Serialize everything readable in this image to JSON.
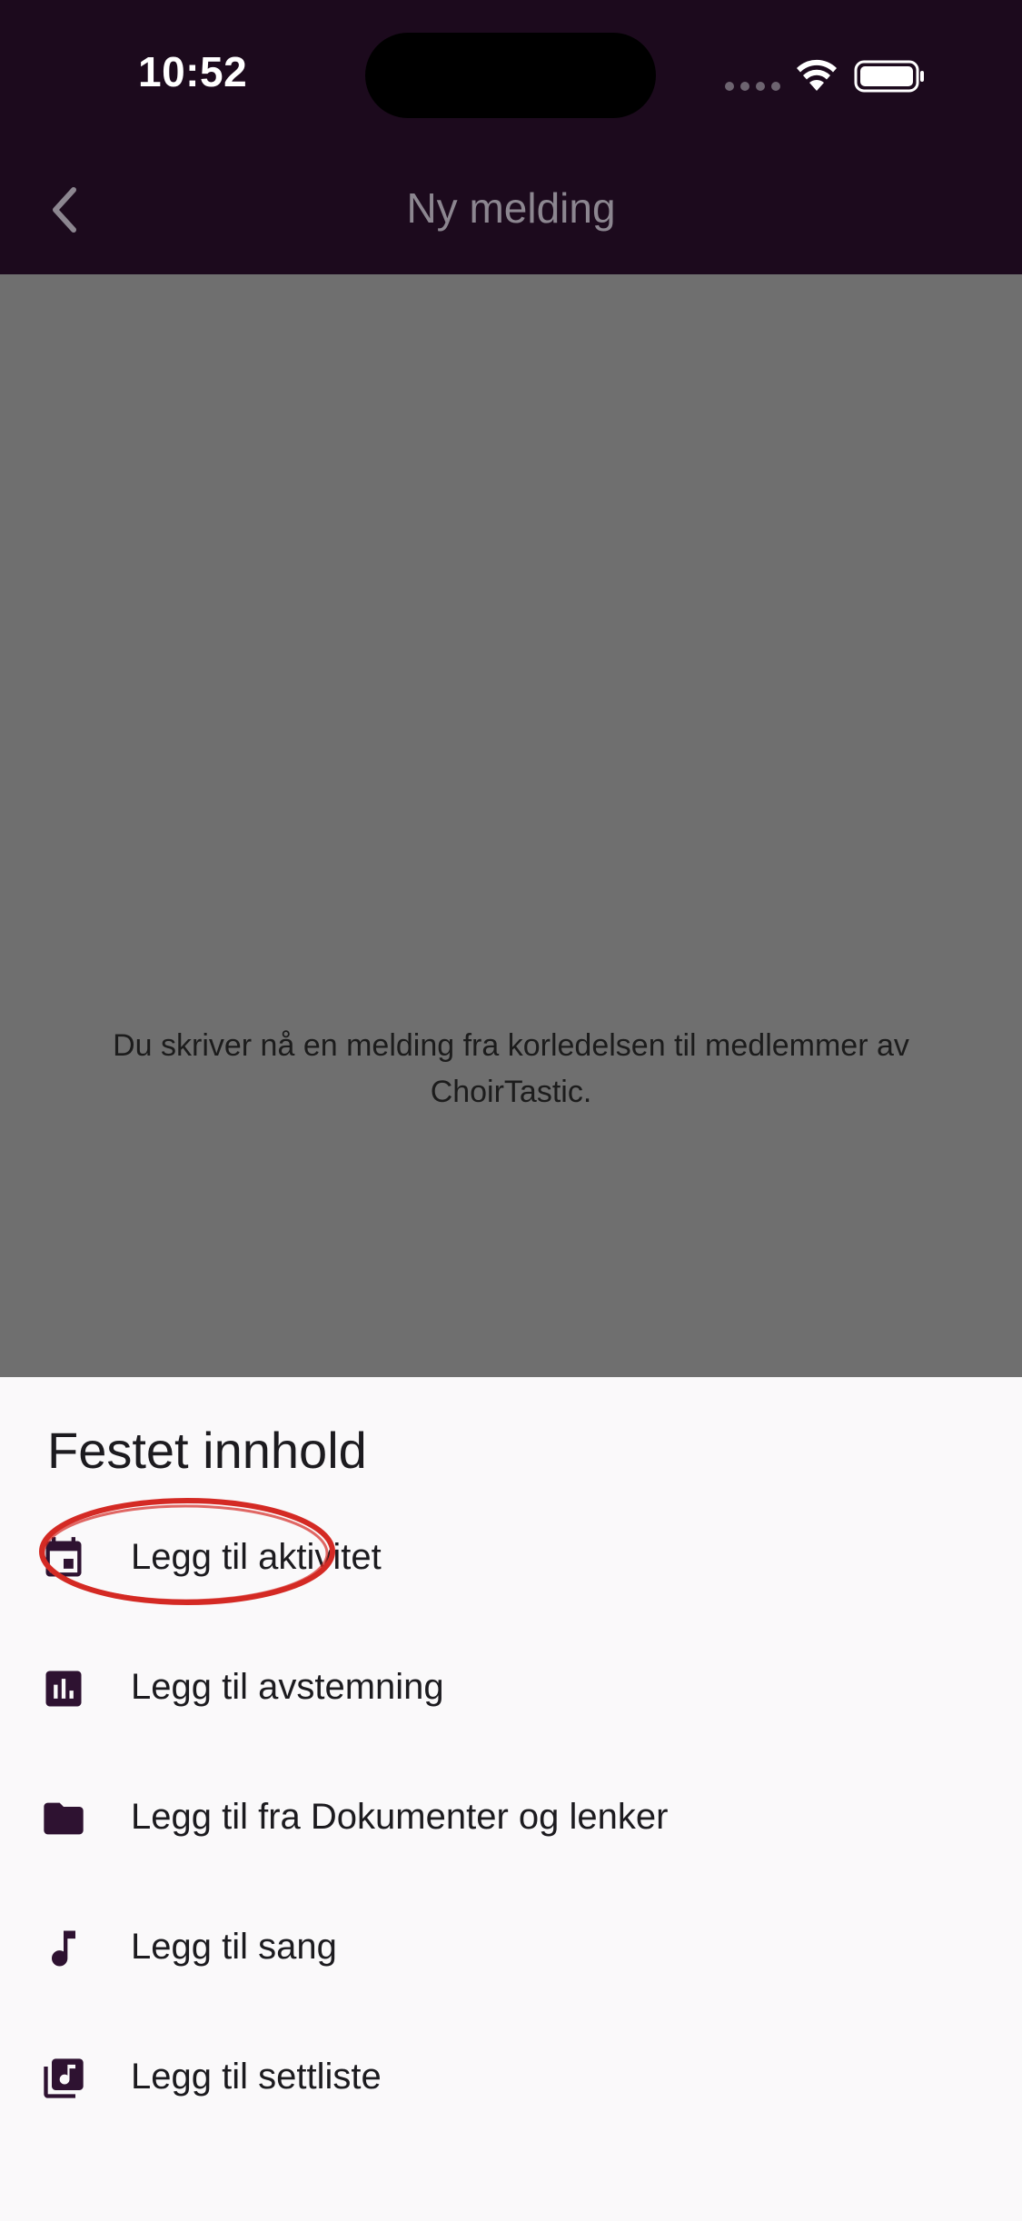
{
  "status_bar": {
    "time": "10:52"
  },
  "app_bar": {
    "title": "Ny melding",
    "back_icon": "chevron-left-icon"
  },
  "body": {
    "message": "Du skriver nå en melding fra korledelsen til medlemmer av ChoirTastic."
  },
  "sheet": {
    "title": "Festet innhold",
    "items": [
      {
        "label": "Legg til aktivitet",
        "icon": "calendar-icon"
      },
      {
        "label": "Legg til avstemning",
        "icon": "poll-icon"
      },
      {
        "label": "Legg til fra Dokumenter og lenker",
        "icon": "folder-icon"
      },
      {
        "label": "Legg til sang",
        "icon": "music-note-icon"
      },
      {
        "label": "Legg til settliste",
        "icon": "library-music-icon"
      }
    ]
  },
  "colors": {
    "status_bg": "#1c0a1d",
    "scrim": "#6f6f6f",
    "sheet_bg": "#faf9fa",
    "icon_color": "#2e1231",
    "annotation": "#d42a24"
  }
}
